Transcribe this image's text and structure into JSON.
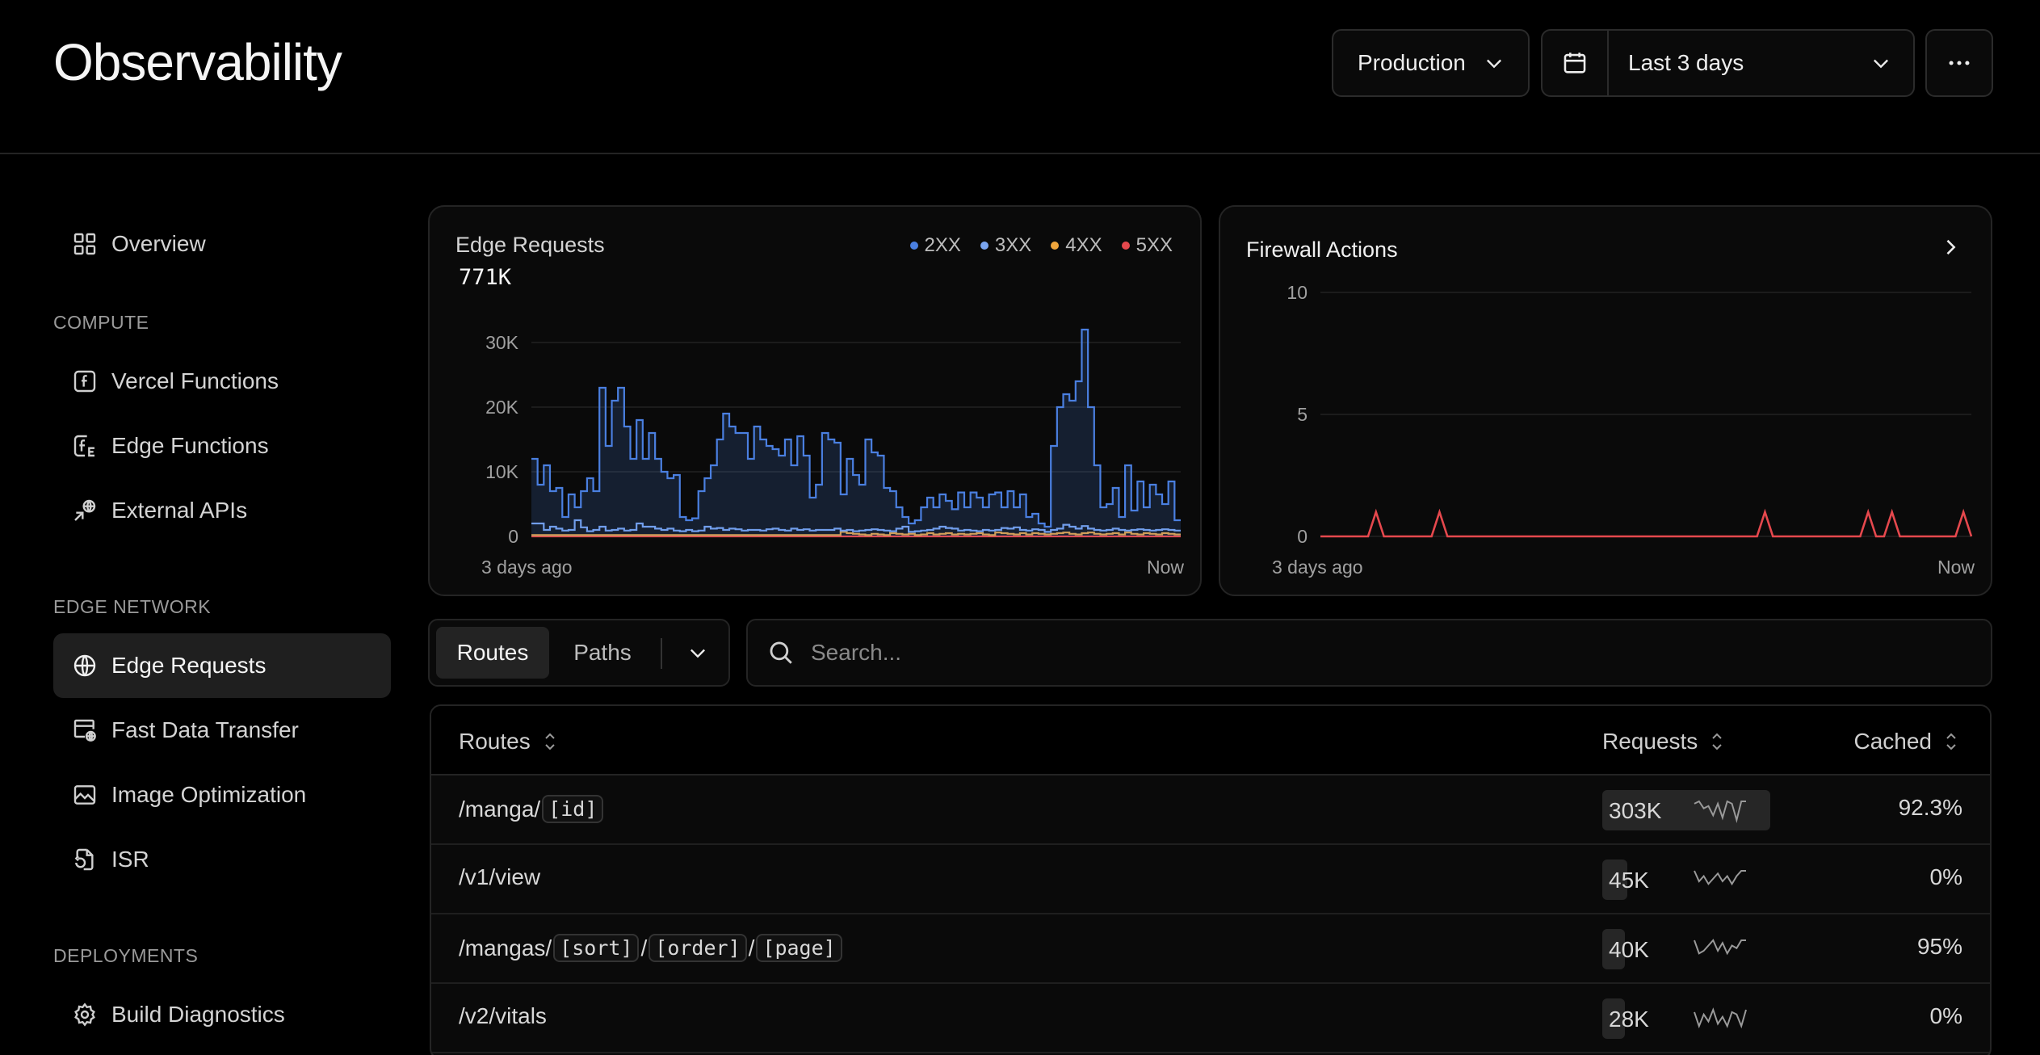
{
  "header": {
    "title": "Observability",
    "environment": "Production",
    "date_range": "Last 3 days"
  },
  "sidebar": {
    "overview": "Overview",
    "sections": [
      {
        "label": "COMPUTE",
        "items": [
          "Vercel Functions",
          "Edge Functions",
          "External APIs"
        ]
      },
      {
        "label": "EDGE NETWORK",
        "items": [
          "Edge Requests",
          "Fast Data Transfer",
          "Image Optimization",
          "ISR"
        ]
      },
      {
        "label": "DEPLOYMENTS",
        "items": [
          "Build Diagnostics"
        ]
      }
    ],
    "active": "Edge Requests"
  },
  "edge_requests": {
    "title": "Edge Requests",
    "total": "771K",
    "legend": [
      {
        "label": "2XX",
        "color": "#4a7fe0"
      },
      {
        "label": "3XX",
        "color": "#7aa5f0"
      },
      {
        "label": "4XX",
        "color": "#f0a63c"
      },
      {
        "label": "5XX",
        "color": "#e5484d"
      }
    ],
    "x_start": "3 days ago",
    "x_end": "Now",
    "y_ticks": [
      "30K",
      "20K",
      "10K",
      "0"
    ]
  },
  "firewall": {
    "title": "Firewall Actions",
    "x_start": "3 days ago",
    "x_end": "Now",
    "y_ticks": [
      "10",
      "5",
      "0"
    ]
  },
  "chart_data": [
    {
      "type": "line",
      "title": "Edge Requests",
      "ylim": [
        0,
        32000
      ],
      "series": [
        {
          "name": "2XX",
          "values": [
            12000,
            8000,
            11000,
            7000,
            7500,
            3000,
            6500,
            4500,
            7000,
            9000,
            7000,
            23000,
            14000,
            21000,
            23000,
            17000,
            12000,
            18000,
            12000,
            16000,
            12000,
            10000,
            9000,
            9500,
            3000,
            2500,
            2800,
            7000,
            9000,
            11000,
            15000,
            19000,
            17000,
            16000,
            16000,
            12000,
            17000,
            15000,
            14000,
            13500,
            12500,
            15000,
            11000,
            15500,
            12500,
            6000,
            8000,
            16000,
            15000,
            14500,
            6500,
            12000,
            9500,
            8000,
            15000,
            13000,
            12500,
            7500,
            7000,
            4500,
            3000,
            2000,
            2500,
            4500,
            6000,
            4500,
            6500,
            5500,
            4200,
            6800,
            4500,
            6800,
            6000,
            4500,
            6500,
            6800,
            4500,
            7000,
            4500,
            6500,
            3000,
            3500,
            2000,
            1500,
            14000,
            20000,
            22000,
            21000,
            24000,
            32000,
            20000,
            11000,
            4500,
            5000,
            7500,
            3000,
            11000,
            4000,
            8500,
            4500,
            8000,
            6500,
            5000,
            8500,
            2500
          ]
        },
        {
          "name": "3XX",
          "values": [
            2000,
            2000,
            1000,
            1500,
            1200,
            900,
            1000,
            2500,
            1400,
            800,
            1000,
            1500,
            900,
            1000,
            1200,
            900,
            1000,
            2000,
            1500,
            1500,
            1200,
            1000,
            1200,
            900,
            800,
            1000,
            800,
            900,
            1500,
            1200,
            1300,
            1000,
            1200,
            1100,
            900,
            1000,
            1000,
            900,
            1100,
            1200,
            1000,
            900,
            1200,
            1000,
            1100,
            900,
            1000,
            1000,
            1000,
            1200,
            900,
            1000,
            800,
            900,
            1000,
            1100,
            1000,
            900,
            800,
            1200,
            1500,
            700,
            800,
            900,
            1000,
            1200,
            1500,
            1300,
            1200,
            900,
            1000,
            900,
            800,
            1000,
            900,
            1000,
            1300,
            1200,
            1400,
            1000,
            900,
            1100,
            1000,
            700,
            1000,
            1200,
            1800,
            1500,
            1200,
            1600,
            1200,
            1000,
            900,
            1000,
            1200,
            1000,
            900,
            1000,
            1100,
            1000,
            900,
            1000,
            1100,
            1000,
            900
          ]
        },
        {
          "name": "4XX",
          "values": [
            200,
            200,
            200,
            200,
            200,
            200,
            200,
            200,
            200,
            200,
            200,
            200,
            200,
            200,
            200,
            200,
            200,
            200,
            200,
            200,
            200,
            200,
            200,
            200,
            200,
            200,
            200,
            200,
            200,
            200,
            200,
            200,
            200,
            200,
            200,
            200,
            200,
            200,
            200,
            200,
            200,
            200,
            200,
            200,
            200,
            200,
            200,
            200,
            200,
            200,
            700,
            500,
            400,
            300,
            200,
            400,
            300,
            200,
            500,
            400,
            300,
            400,
            200,
            300,
            500,
            300,
            400,
            500,
            300,
            400,
            300,
            400,
            500,
            300,
            200,
            600,
            500,
            400,
            300,
            500,
            300,
            500,
            400,
            300,
            400,
            500,
            600,
            400,
            300,
            500,
            600,
            400,
            300,
            400,
            500,
            300,
            600,
            400,
            300,
            500,
            400,
            300,
            500,
            400,
            300
          ]
        },
        {
          "name": "5XX",
          "values": [
            0,
            0,
            0,
            0,
            0,
            0,
            0,
            0,
            0,
            0,
            0,
            0,
            0,
            0,
            0,
            0,
            0,
            0,
            0,
            0,
            0,
            0,
            0,
            0,
            0,
            0,
            0,
            0,
            0,
            0,
            0,
            0,
            0,
            0,
            0,
            0,
            0,
            0,
            0,
            0,
            0,
            0,
            0,
            0,
            0,
            0,
            0,
            0,
            0,
            0,
            0,
            0,
            0,
            0,
            0,
            0,
            0,
            0,
            0,
            0,
            0,
            0,
            0,
            0,
            0,
            0,
            0,
            0,
            0,
            0,
            0,
            0,
            0,
            0,
            0,
            0,
            0,
            0,
            0,
            0,
            0,
            0,
            0,
            0,
            0,
            0,
            0,
            0,
            0,
            0,
            0,
            0,
            0,
            0,
            0,
            0,
            0,
            0,
            0,
            0,
            0,
            0,
            0,
            0,
            0
          ]
        }
      ]
    },
    {
      "type": "line",
      "title": "Firewall Actions",
      "ylim": [
        0,
        10
      ],
      "series": [
        {
          "name": "",
          "color": "#e5484d",
          "values": [
            0,
            0,
            0,
            0,
            0,
            0,
            0,
            1,
            0,
            0,
            0,
            0,
            0,
            0,
            0,
            1,
            0,
            0,
            0,
            0,
            0,
            0,
            0,
            0,
            0,
            0,
            0,
            0,
            0,
            0,
            0,
            0,
            0,
            0,
            0,
            0,
            0,
            0,
            0,
            0,
            0,
            0,
            0,
            0,
            0,
            0,
            0,
            0,
            0,
            0,
            0,
            0,
            0,
            0,
            0,
            0,
            1,
            0,
            0,
            0,
            0,
            0,
            0,
            0,
            0,
            0,
            0,
            0,
            0,
            1,
            0,
            0,
            1,
            0,
            0,
            0,
            0,
            0,
            0,
            0,
            0,
            1,
            0
          ]
        }
      ]
    }
  ],
  "tabs": [
    {
      "label": "Routes",
      "active": true
    },
    {
      "label": "Paths",
      "active": false
    }
  ],
  "search": {
    "placeholder": "Search..."
  },
  "table": {
    "columns": [
      "Routes",
      "Requests",
      "Cached"
    ],
    "rows": [
      {
        "route": [
          "/manga/",
          "[id]"
        ],
        "requests": "303K",
        "requests_fraction": 1.0,
        "cached": "92.3%",
        "spark": [
          8,
          9,
          6,
          7,
          3,
          8,
          2,
          9,
          8,
          1,
          9,
          9
        ]
      },
      {
        "route": [
          "/v1/view"
        ],
        "requests": "45K",
        "requests_fraction": 0.15,
        "cached": "0%",
        "spark": [
          8,
          4,
          6,
          3,
          5,
          7,
          4,
          6,
          3,
          6,
          8,
          8
        ]
      },
      {
        "route": [
          "/mangas/",
          "[sort]",
          "/",
          "[order]",
          "/",
          "[page]"
        ],
        "requests": "40K",
        "requests_fraction": 0.13,
        "cached": "95%",
        "spark": [
          8,
          3,
          4,
          6,
          8,
          4,
          7,
          3,
          6,
          5,
          8,
          8
        ]
      },
      {
        "route": [
          "/v2/vitals"
        ],
        "requests": "28K",
        "requests_fraction": 0.09,
        "cached": "0%",
        "spark": [
          8,
          2,
          7,
          4,
          9,
          3,
          6,
          2,
          8,
          7,
          2,
          9
        ]
      }
    ]
  }
}
